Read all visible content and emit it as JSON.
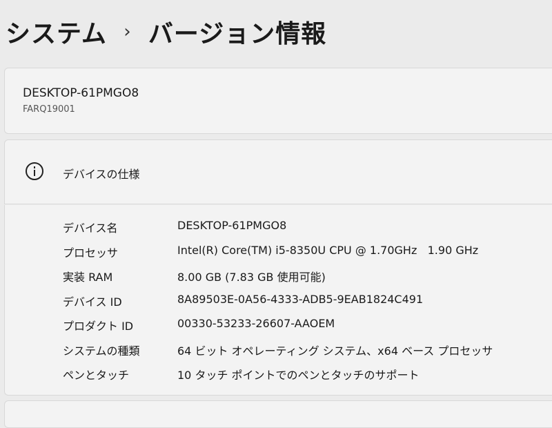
{
  "breadcrumb": {
    "parent": "システム",
    "separator": "›",
    "current": "バージョン情報"
  },
  "device": {
    "name": "DESKTOP-61PMGO8",
    "model": "FARQ19001"
  },
  "device_specs": {
    "icon": "info-icon",
    "title": "デバイスの仕様",
    "rows": [
      {
        "label": "デバイス名",
        "value": "DESKTOP-61PMGO8"
      },
      {
        "label": "プロセッサ",
        "value": "Intel(R) Core(TM) i5-8350U CPU @ 1.70GHz   1.90 GHz"
      },
      {
        "label": "実装 RAM",
        "value": "8.00 GB (7.83 GB 使用可能)"
      },
      {
        "label": "デバイス ID",
        "value": "8A89503E-0A56-4333-ADB5-9EAB1824C491"
      },
      {
        "label": "プロダクト ID",
        "value": "00330-53233-26607-AAOEM"
      },
      {
        "label": "システムの種類",
        "value": "64 ビット オペレーティング システム、x64 ベース プロセッサ"
      },
      {
        "label": "ペンとタッチ",
        "value": "10 タッチ ポイントでのペンとタッチのサポート"
      }
    ]
  }
}
